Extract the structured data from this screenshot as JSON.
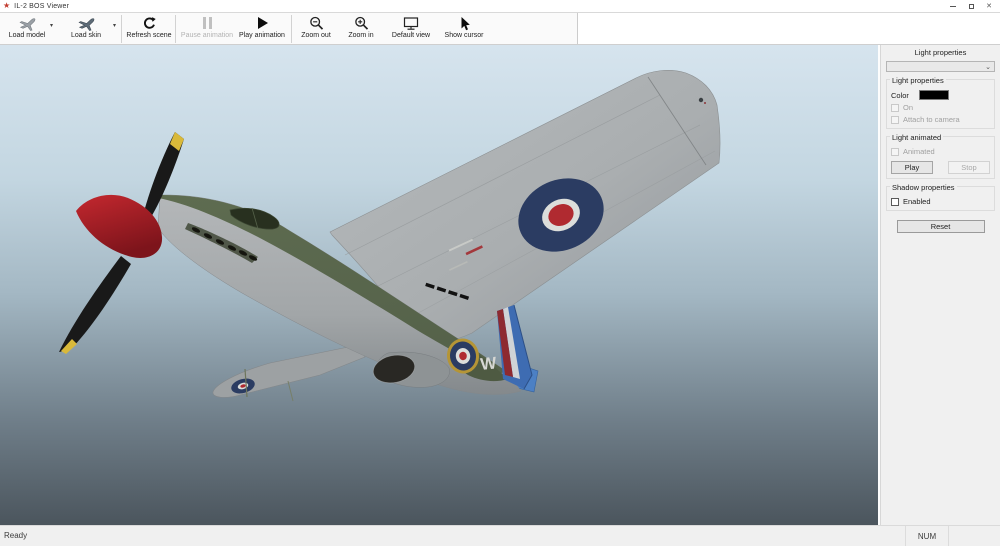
{
  "window": {
    "title": "IL-2 BOS Viewer",
    "app_icon_glyph": "★",
    "controls": {
      "close_glyph": "✕"
    }
  },
  "toolbar": {
    "buttons": [
      {
        "label": "Load model",
        "icon": "airplane-icon",
        "enabled": true,
        "dropdown": true
      },
      {
        "label": "Load skin",
        "icon": "airplane-dark-icon",
        "enabled": true,
        "dropdown": true
      },
      {
        "label": "Refresh scene",
        "icon": "refresh-icon",
        "enabled": true
      },
      {
        "label": "Pause animation",
        "icon": "pause-icon",
        "enabled": false
      },
      {
        "label": "Play animation",
        "icon": "play-icon",
        "enabled": true
      },
      {
        "label": "Zoom out",
        "icon": "magnifier-minus-icon",
        "enabled": true
      },
      {
        "label": "Zoom in",
        "icon": "magnifier-plus-icon",
        "enabled": true
      },
      {
        "label": "Default view",
        "icon": "monitor-icon",
        "enabled": true
      },
      {
        "label": "Show cursor",
        "icon": "cursor-icon",
        "enabled": true
      }
    ],
    "dropdown_glyph": "▾"
  },
  "sidebar": {
    "header": "Light properties",
    "light_select": {
      "selected": "",
      "chevron_glyph": "⌄"
    },
    "groups": {
      "light_properties": {
        "title": "Light properties",
        "color_label": "Color",
        "color_value": "#000000",
        "on_checkbox": {
          "label": "On",
          "checked": false,
          "enabled": false
        },
        "attach_checkbox": {
          "label": "Attach to camera",
          "checked": false,
          "enabled": false
        }
      },
      "light_animated": {
        "title": "Light animated",
        "animated_checkbox": {
          "label": "Animated",
          "checked": false,
          "enabled": false
        },
        "play_label": "Play",
        "stop_label": "Stop"
      },
      "shadow_properties": {
        "title": "Shadow properties",
        "enabled_checkbox": {
          "label": "Enabled",
          "checked": false,
          "enabled": true
        }
      }
    },
    "reset_label": "Reset"
  },
  "viewport": {
    "aircraft": {
      "code_letter": "W"
    },
    "colors": {
      "sky_top": "#d6e4ee",
      "sky_bottom": "#4b555d",
      "spinner_red": "#c4282f",
      "prop_tip_yellow": "#d9b93a",
      "metal_silver": "#aaaeb0",
      "camo_green": "#55624a",
      "roundel_blue": "#2b3c62",
      "roundel_white": "#dcdedb",
      "roundel_red": "#b02a30",
      "roundel_yellow": "#b59536",
      "fin_blue": "#3e6cb2"
    }
  },
  "statusbar": {
    "left": "Ready",
    "num_indicator": "NUM"
  }
}
